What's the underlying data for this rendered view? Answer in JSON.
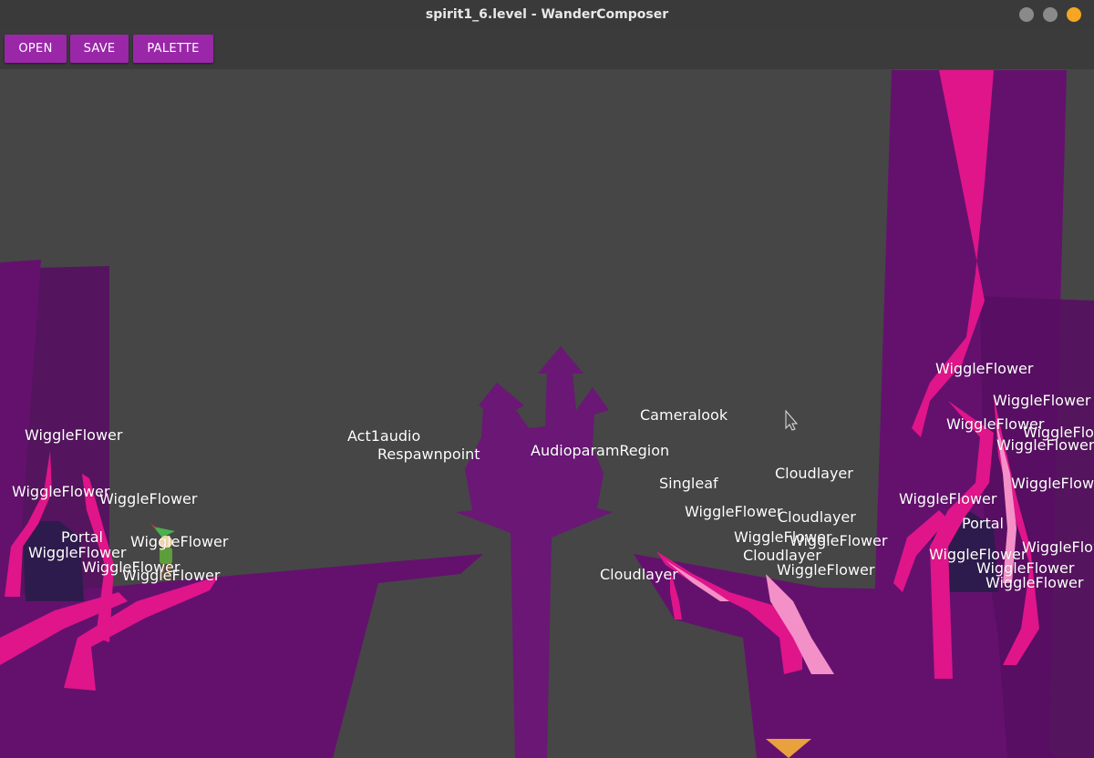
{
  "window": {
    "title": "spirit1_6.level - WanderComposer",
    "controls": {
      "minimize_color": "#8a8a8a",
      "maximize_color": "#8a8a8a",
      "close_color": "#f5a623"
    }
  },
  "toolbar": {
    "open_label": "OPEN",
    "save_label": "SAVE",
    "palette_label": "PALETTE",
    "button_color": "#9a27a8"
  },
  "scene": {
    "colors": {
      "terrain": "#64116e",
      "terrain_dark": "#560e60",
      "castle": "#6a1776",
      "flower": "#e0158a",
      "flower_light": "#f490c8",
      "portal": "#2e1b4d",
      "marker": "#e9a13e",
      "background": "#464646"
    },
    "labels": {
      "wf1": "WiggleFlower",
      "wf2": "WiggleFlower",
      "wf3": "WiggleFlower",
      "portal_left": "Portal",
      "wf4": "WiggleFlower",
      "wf5": "WiggleFlower",
      "wf6": "WiggleFlower",
      "wf7": "WiggleFlower",
      "act1audio": "Act1audio",
      "respawn": "Respawnpoint",
      "audioparam": "AudioparamRegion",
      "cameralook": "Cameralook",
      "singleaf": "Singleaf",
      "cloud1": "Cloudlayer",
      "cloud2": "Cloudlayer",
      "cloud3": "Cloudlayer",
      "cloud4": "Cloudlayer",
      "wf8": "WiggleFlower",
      "wf9": "WiggleFlower",
      "wf10": "WiggleFlower",
      "wf11": "WiggleFlower",
      "wf12": "WiggleFlower",
      "wf13": "WiggleFlower",
      "wf14": "WiggleFlower",
      "wf15": "WiggleFlower",
      "wf16": "WiggleFlower",
      "wf17": "WiggleFlower",
      "wf18": "WiggleFlower",
      "wf19": "WiggleFlower",
      "wf20": "WiggleFlower",
      "wf21": "WiggleFlower",
      "wf22": "WiggleFlower",
      "portal_right": "Portal"
    }
  }
}
